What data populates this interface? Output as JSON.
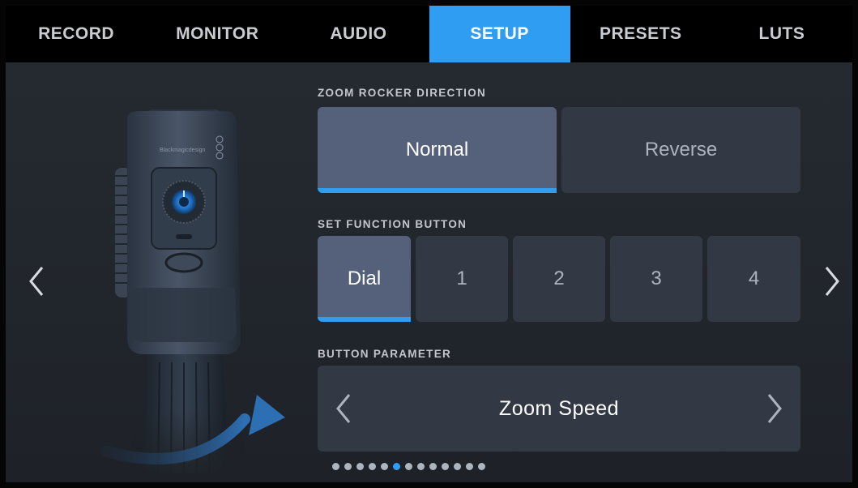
{
  "tabs": [
    {
      "label": "RECORD",
      "active": false
    },
    {
      "label": "MONITOR",
      "active": false
    },
    {
      "label": "AUDIO",
      "active": false
    },
    {
      "label": "SETUP",
      "active": true
    },
    {
      "label": "PRESETS",
      "active": false
    },
    {
      "label": "LUTS",
      "active": false
    }
  ],
  "zoom_rocker": {
    "label": "ZOOM ROCKER DIRECTION",
    "options": [
      "Normal",
      "Reverse"
    ],
    "selected": "Normal"
  },
  "function_button": {
    "label": "SET FUNCTION BUTTON",
    "options": [
      "Dial",
      "1",
      "2",
      "3",
      "4"
    ],
    "selected": "Dial"
  },
  "button_parameter": {
    "label": "BUTTON PARAMETER",
    "value": "Zoom Speed"
  },
  "pagination": {
    "total_pages": 13,
    "current_page": 6
  },
  "colors": {
    "accent": "#2f9df2",
    "selected_bg": "#55617a",
    "control_bg": "#323945"
  },
  "icons": {
    "prev_page": "chevron-left-icon",
    "next_page": "chevron-right-icon",
    "param_prev": "chevron-left-icon",
    "param_next": "chevron-right-icon"
  }
}
